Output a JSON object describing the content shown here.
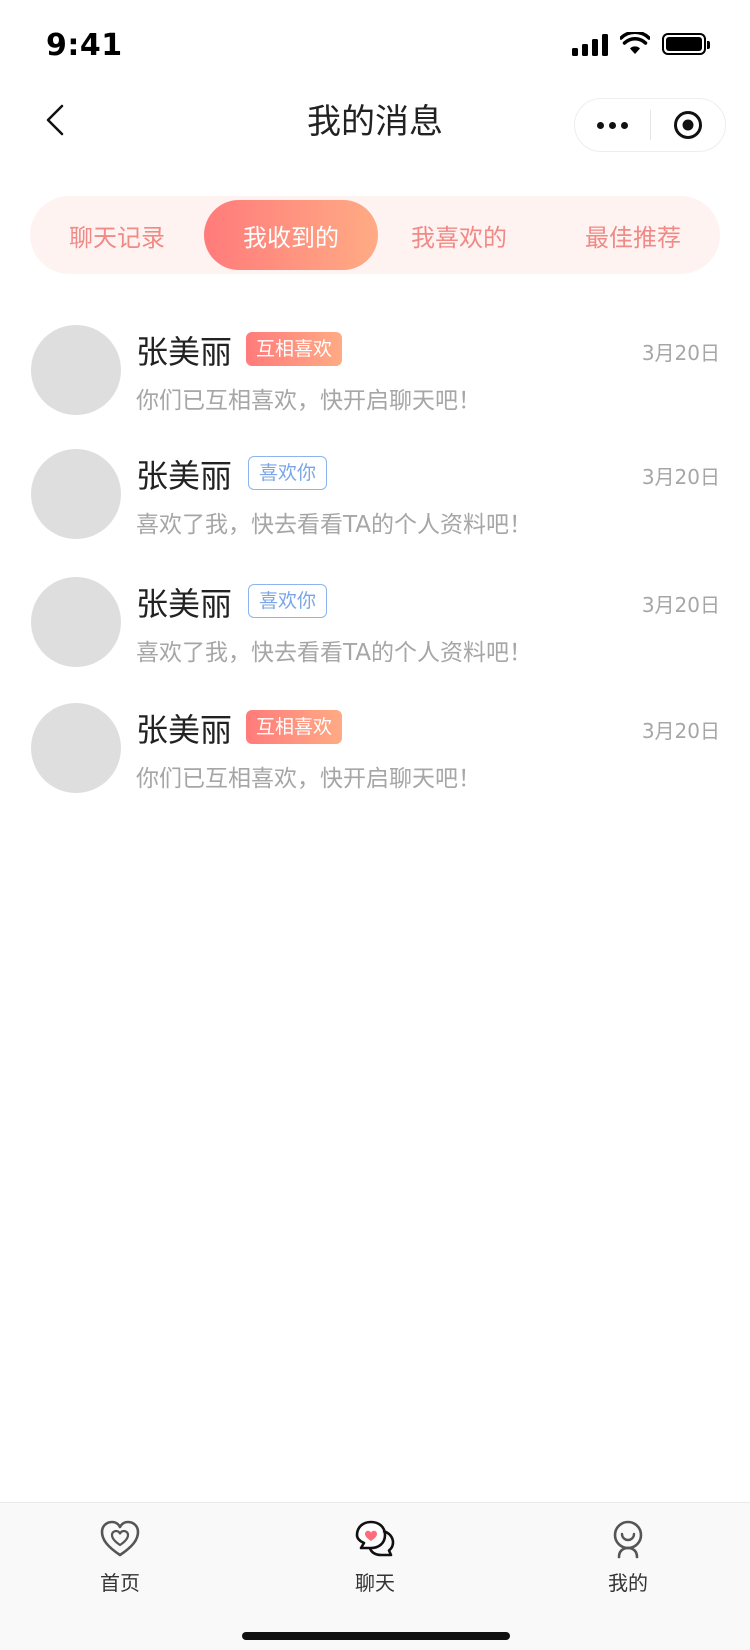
{
  "status_bar": {
    "time": "9:41"
  },
  "nav": {
    "title": "我的消息"
  },
  "tabs": [
    {
      "label": "聊天记录",
      "active": false
    },
    {
      "label": "我收到的",
      "active": true
    },
    {
      "label": "我喜欢的",
      "active": false
    },
    {
      "label": "最佳推荐",
      "active": false
    }
  ],
  "messages": [
    {
      "name": "张美丽",
      "tag": "互相喜欢",
      "tag_type": "mutual",
      "date": "3月20日",
      "text": "你们已互相喜欢，快开启聊天吧！"
    },
    {
      "name": "张美丽",
      "tag": "喜欢你",
      "tag_type": "likes",
      "date": "3月20日",
      "text": "喜欢了我，快去看看TA的个人资料吧！"
    },
    {
      "name": "张美丽",
      "tag": "喜欢你",
      "tag_type": "likes",
      "date": "3月20日",
      "text": "喜欢了我，快去看看TA的个人资料吧！"
    },
    {
      "name": "张美丽",
      "tag": "互相喜欢",
      "tag_type": "mutual",
      "date": "3月20日",
      "text": "你们已互相喜欢，快开启聊天吧！"
    }
  ],
  "tab_bar": [
    {
      "label": "首页",
      "icon": "heart-home-icon"
    },
    {
      "label": "聊天",
      "icon": "chat-heart-icon"
    },
    {
      "label": "我的",
      "icon": "profile-icon"
    }
  ],
  "colors": {
    "accent_start": "#ff7b7b",
    "accent_end": "#ffab84",
    "tab_text": "#f08a86",
    "likes_tag": "#7aa6e6"
  }
}
